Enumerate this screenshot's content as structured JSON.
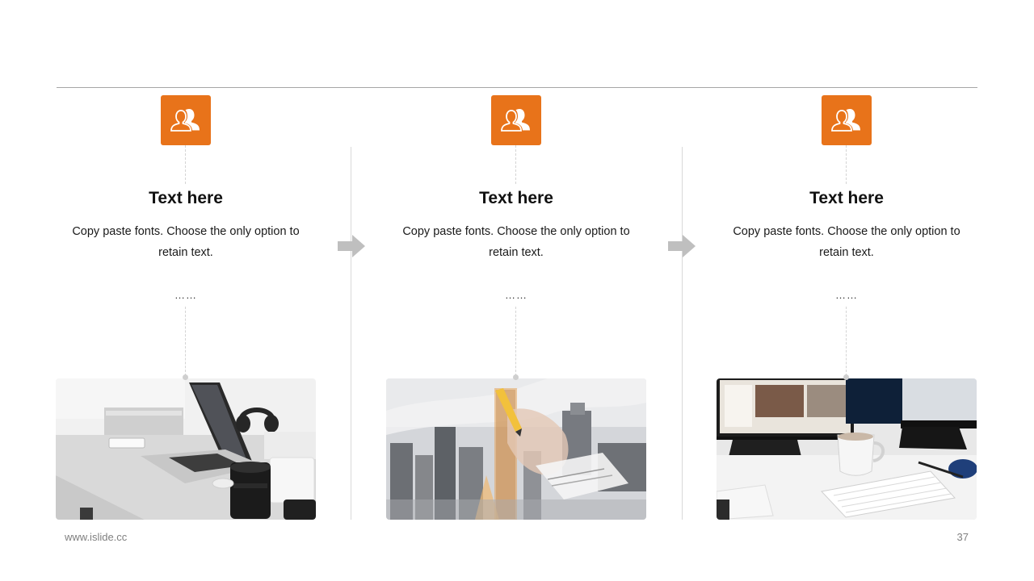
{
  "columns": [
    {
      "icon": "users-icon",
      "title": "Text here",
      "description": "Copy paste fonts. Choose the only option to retain text.",
      "ellipsis": "……",
      "image": "laptop-desk-photo"
    },
    {
      "icon": "users-icon",
      "title": "Text here",
      "description": "Copy paste fonts. Choose the only option to retain text.",
      "ellipsis": "……",
      "image": "city-handwriting-photo"
    },
    {
      "icon": "users-icon",
      "title": "Text here",
      "description": "Copy paste fonts. Choose the only option to retain text.",
      "ellipsis": "……",
      "image": "monitor-keyboard-photo"
    }
  ],
  "footer": {
    "url": "www.islide.cc",
    "page_number": "37"
  },
  "colors": {
    "accent": "#E8731A",
    "arrow": "#BFBFBF",
    "rule": "#A6A6A6"
  }
}
